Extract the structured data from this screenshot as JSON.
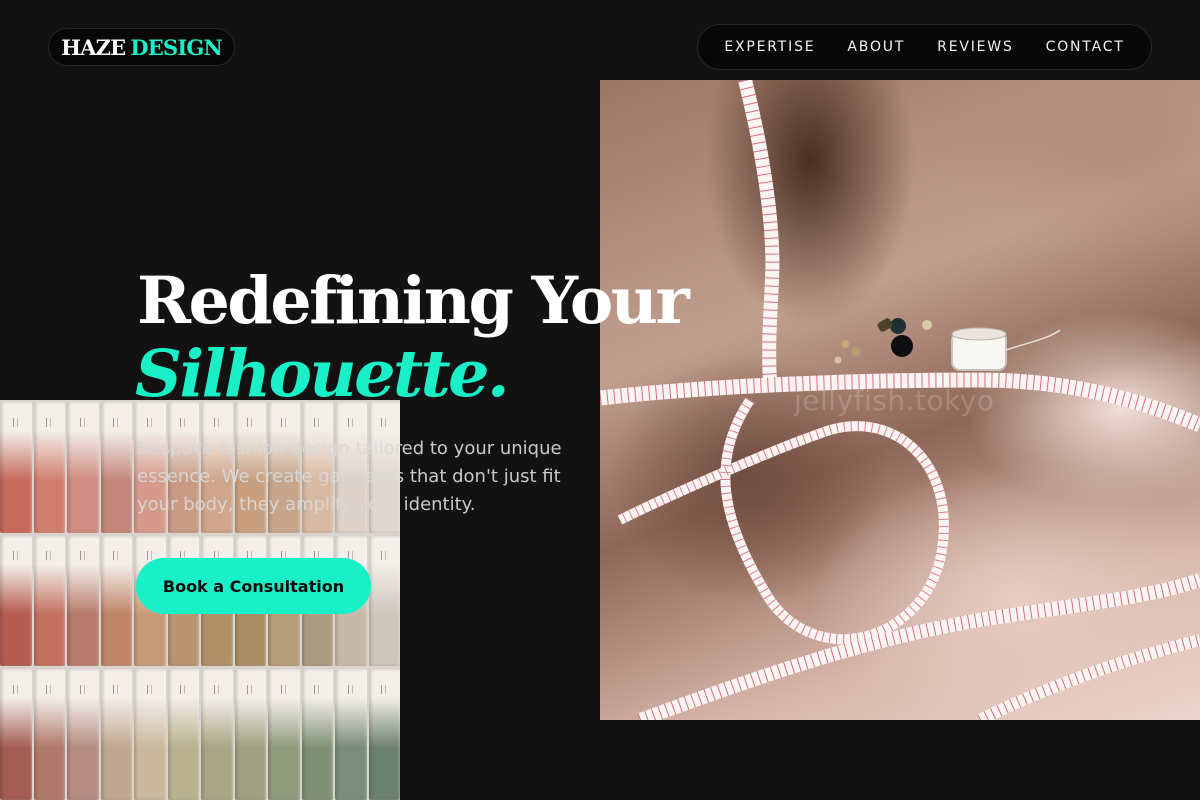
{
  "brand": {
    "word1": "HAZE",
    "word2": "DESIGN",
    "accent_color": "#19f0c8"
  },
  "nav": {
    "items": [
      {
        "label": "EXPERTISE"
      },
      {
        "label": "ABOUT"
      },
      {
        "label": "REVIEWS"
      },
      {
        "label": "CONTACT"
      }
    ]
  },
  "hero": {
    "headline_line1": "Redefining Your",
    "headline_line2": "Silhouette.",
    "description": "Bespoke fashion design tailored to your unique essence. We create garments that don't just fit your body, they amplify your identity.",
    "cta_label": "Book a Consultation"
  },
  "images": {
    "fabric_photo": {
      "icon": "fabric-tape-measure-photo",
      "watermark": "jellyfish.tokyo"
    },
    "swatch_photo": {
      "icon": "color-swatch-cards-photo"
    }
  },
  "colors": {
    "background": "#121212",
    "accent": "#19f0c8",
    "text": "#ffffff"
  }
}
